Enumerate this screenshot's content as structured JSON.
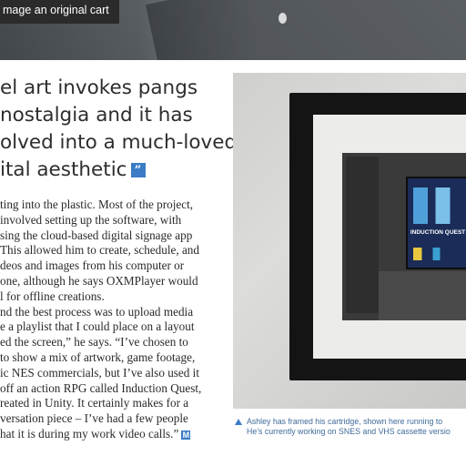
{
  "top_caption": "mage an original cart",
  "pull_quote": {
    "lines": [
      "el art invokes pangs",
      "nostalgia and it has",
      "olved into a much-loved",
      "ital aesthetic"
    ],
    "quote_glyph": "”"
  },
  "body": {
    "lines": [
      "ting into the plastic. Most of the project,",
      "involved setting up the software, with",
      "sing the cloud-based digital signage app",
      "This allowed him to create, schedule, and",
      "deos and images from his computer or",
      "one, although he says OXMPlayer would",
      "l for offline creations.",
      "nd the best process was to upload media",
      "e a playlist that I could place on a layout",
      "ed the screen,” he says. “I’ve chosen to",
      "to show a mix of artwork, game footage,",
      "ic NES commercials, but I’ve also used it",
      "off an action RPG called Induction Quest,",
      "reated in Unity. It certainly makes for a",
      "versation piece – I’ve had a few people",
      "hat it is during my work video calls.”"
    ],
    "end_glyph": "M"
  },
  "photo": {
    "screen_title": "INDUCTION QUEST"
  },
  "caption": {
    "lines": [
      "Ashley has framed his cartridge, shown here running to",
      "He’s currently working on SNES and VHS cassette versio"
    ]
  },
  "colors": {
    "accent": "#3a7cc6",
    "caption_text": "#3f6a9a"
  }
}
